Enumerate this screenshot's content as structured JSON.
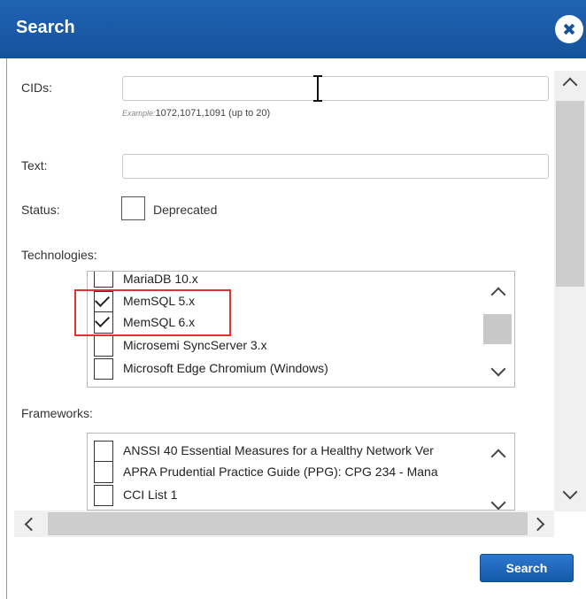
{
  "dialog": {
    "title": "Search",
    "submit_label": "Search"
  },
  "form": {
    "cids": {
      "label": "CIDs:",
      "value": "",
      "hint_prefix": "Example:",
      "hint_text": "1072,1071,1091 (up to 20)"
    },
    "text": {
      "label": "Text:",
      "value": ""
    },
    "status": {
      "label": "Status:",
      "option_label": "Deprecated",
      "checked": false
    },
    "technologies": {
      "label": "Technologies:",
      "items": [
        {
          "label": "MariaDB 10.x",
          "checked": false
        },
        {
          "label": "MemSQL 5.x",
          "checked": true
        },
        {
          "label": "MemSQL 6.x",
          "checked": true
        },
        {
          "label": "Microsemi SyncServer 3.x",
          "checked": false
        },
        {
          "label": "Microsoft Edge Chromium (Windows)",
          "checked": false
        }
      ],
      "highlight_color": "#e0332d"
    },
    "frameworks": {
      "label": "Frameworks:",
      "items": [
        {
          "label": "ANSSI 40 Essential Measures for a Healthy Network Ver",
          "checked": false
        },
        {
          "label": "APRA Prudential Practice Guide (PPG): CPG 234 - Mana",
          "checked": false
        },
        {
          "label": "CCI List 1",
          "checked": false
        }
      ]
    }
  },
  "colors": {
    "titlebar": "#1a5ca8",
    "button": "#1e67bb"
  }
}
